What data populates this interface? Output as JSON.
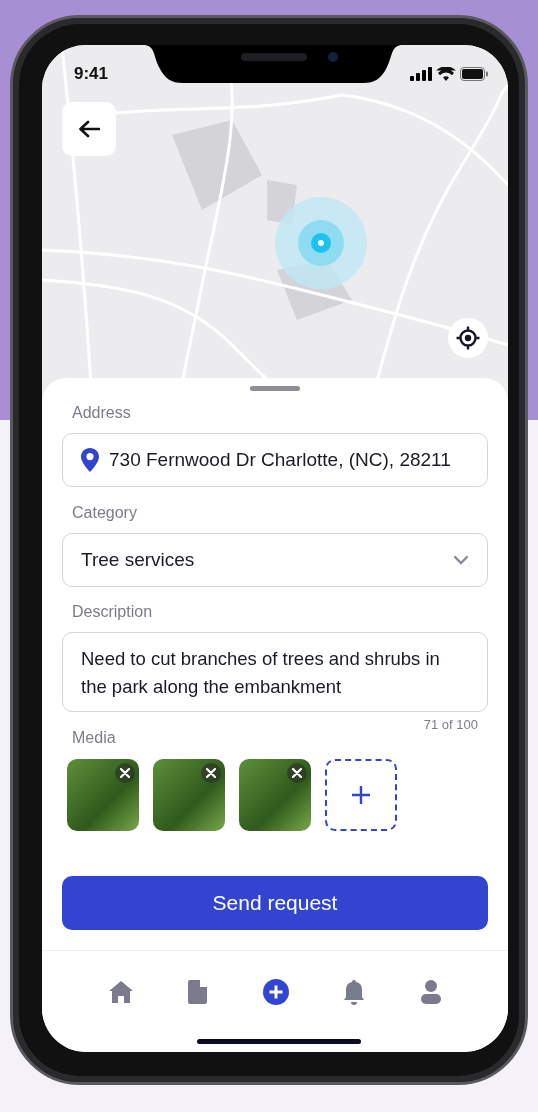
{
  "status_bar": {
    "time": "9:41"
  },
  "form": {
    "fields": [
      {
        "kind": "address",
        "label": "Address",
        "value": "730 Fernwood Dr Charlotte, (NC), 28211"
      },
      {
        "kind": "select",
        "label": "Category",
        "value": "Tree services"
      },
      {
        "kind": "textarea",
        "label": "Description",
        "value": "Need to cut branches of trees and shrubs in the park along the embankment",
        "counter": "71 of 100"
      }
    ],
    "media": {
      "label": "Media",
      "items": [
        {
          "kind": "photo"
        },
        {
          "kind": "photo"
        },
        {
          "kind": "photo"
        },
        {
          "kind": "add"
        }
      ]
    },
    "submit": "Send request"
  },
  "nav": [
    {
      "kind": "home",
      "selected": false
    },
    {
      "kind": "document",
      "selected": false
    },
    {
      "kind": "add",
      "selected": true
    },
    {
      "kind": "bell",
      "selected": false
    },
    {
      "kind": "profile",
      "selected": false
    }
  ]
}
